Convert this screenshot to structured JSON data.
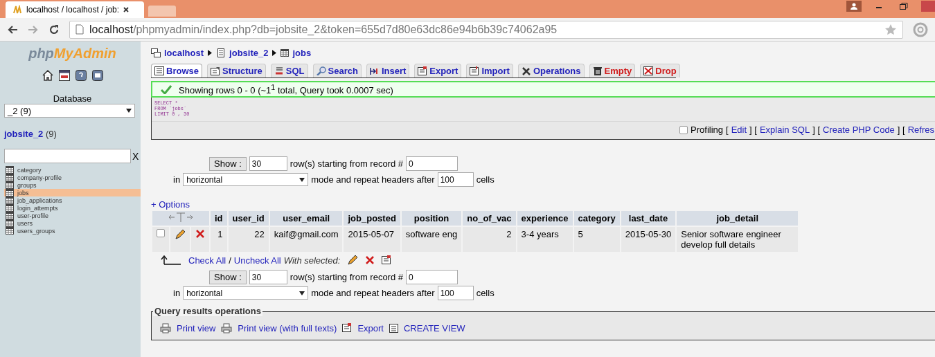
{
  "browser": {
    "tab_title": "localhost / localhost / job:",
    "url_host": "localhost",
    "url_path": "/phpmyadmin/index.php?db=jobsite_2&token=655d7d80e63dc86e94b6b39c74062a95"
  },
  "sidebar": {
    "logo_left": "php",
    "logo_right": "MyAdmin",
    "database_label": "Database",
    "database_value": "_2 (9)",
    "db_name": "jobsite_2",
    "db_count": "(9)",
    "filter_clear": "X",
    "tables": [
      {
        "name": "category",
        "selected": false
      },
      {
        "name": "company-profile",
        "selected": false
      },
      {
        "name": "groups",
        "selected": false
      },
      {
        "name": "jobs",
        "selected": true
      },
      {
        "name": "job_applications",
        "selected": false
      },
      {
        "name": "login_attempts",
        "selected": false
      },
      {
        "name": "user-profile",
        "selected": false
      },
      {
        "name": "users",
        "selected": false
      },
      {
        "name": "users_groups",
        "selected": false
      }
    ]
  },
  "breadcrumb": [
    {
      "label": "localhost",
      "kind": "server"
    },
    {
      "label": "jobsite_2",
      "kind": "database"
    },
    {
      "label": "jobs",
      "kind": "table"
    }
  ],
  "tabs": [
    {
      "label": "Browse",
      "selected": true,
      "kind": "normal"
    },
    {
      "label": "Structure",
      "selected": false,
      "kind": "normal"
    },
    {
      "label": "SQL",
      "selected": false,
      "kind": "normal"
    },
    {
      "label": "Search",
      "selected": false,
      "kind": "normal"
    },
    {
      "label": "Insert",
      "selected": false,
      "kind": "normal"
    },
    {
      "label": "Export",
      "selected": false,
      "kind": "normal"
    },
    {
      "label": "Import",
      "selected": false,
      "kind": "normal"
    },
    {
      "label": "Operations",
      "selected": false,
      "kind": "normal"
    },
    {
      "label": "Empty",
      "selected": false,
      "kind": "danger"
    },
    {
      "label": "Drop",
      "selected": false,
      "kind": "danger"
    }
  ],
  "notice": "Showing rows 0 - 0 (~1$^{1}$ total, Query took 0.0007 sec)",
  "sql_lines": [
    "SELECT *",
    "FROM `jobs`",
    "LIMIT 0 , 30"
  ],
  "sql_tools": {
    "profiling": {
      "label": "Profiling",
      "checked": false
    },
    "parts": [
      {
        "kind": "text",
        "text": "["
      },
      {
        "kind": "link",
        "text": "Edit"
      },
      {
        "kind": "text",
        "text": "] ["
      },
      {
        "kind": "link",
        "text": "Explain SQL"
      },
      {
        "kind": "text",
        "text": "] ["
      },
      {
        "kind": "link",
        "text": "Create PHP Code"
      },
      {
        "kind": "text",
        "text": "] ["
      },
      {
        "kind": "link",
        "text": "Refres"
      }
    ]
  },
  "navigation": [
    {
      "show_button": "Show :",
      "rows": "30",
      "rows_label": "row(s) starting from record #",
      "start": "0",
      "in_label": "in",
      "mode": "horizontal",
      "mode_label": "mode and repeat headers after",
      "repeat": "100",
      "cells_label": "cells"
    },
    {
      "show_button": "Show :",
      "rows": "30",
      "rows_label": "row(s) starting from record #",
      "start": "0",
      "in_label": "in",
      "mode": "horizontal",
      "mode_label": "mode and repeat headers after",
      "repeat": "100",
      "cells_label": "cells"
    }
  ],
  "options_link": "+ Options",
  "table": {
    "columns": [
      {
        "label": "id",
        "numeric": true
      },
      {
        "label": "user_id",
        "numeric": true
      },
      {
        "label": "user_email",
        "numeric": false
      },
      {
        "label": "job_posted",
        "numeric": false
      },
      {
        "label": "position",
        "numeric": false
      },
      {
        "label": "no_of_vac",
        "numeric": true
      },
      {
        "label": "experience",
        "numeric": false
      },
      {
        "label": "category",
        "numeric": false
      },
      {
        "label": "last_date",
        "numeric": false
      },
      {
        "label": "job_detail",
        "numeric": false
      }
    ],
    "rows": [
      {
        "checked": false,
        "cells": [
          "1",
          "22",
          "kaif@gmail.com",
          "2015-05-07",
          "software eng",
          "2",
          "3-4 years",
          "5",
          "2015-05-30",
          "Senior software engineer develop full details"
        ]
      }
    ]
  },
  "bulk": {
    "check_all": "Check All",
    "separator": "/",
    "uncheck_all": "Uncheck All",
    "with_selected": "With selected:"
  },
  "query_ops": {
    "legend": "Query results operations",
    "links": [
      {
        "label": "Print view",
        "kind": "print"
      },
      {
        "label": "Print view (with full texts)",
        "kind": "print"
      },
      {
        "label": "Export",
        "kind": "export"
      },
      {
        "label": "CREATE VIEW",
        "kind": "view"
      }
    ]
  }
}
